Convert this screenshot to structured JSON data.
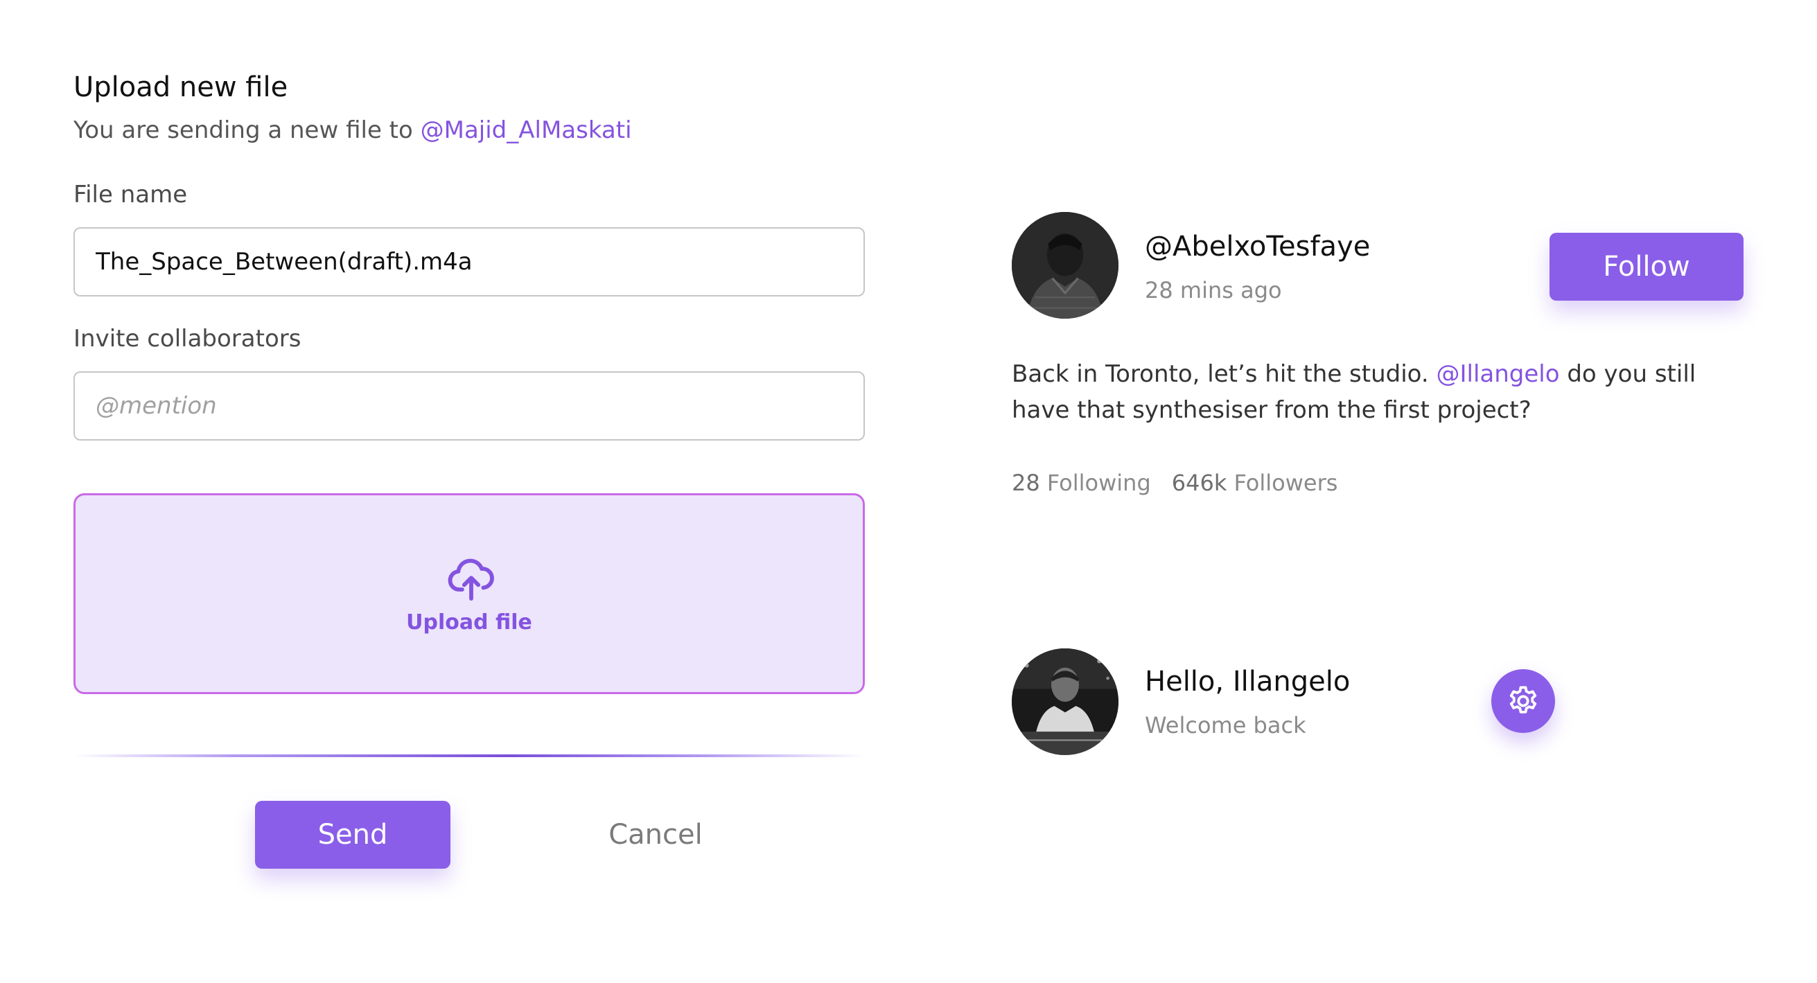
{
  "upload": {
    "title": "Upload new file",
    "subtitle_prefix": "You are sending a new file to ",
    "recipient": "@Majid_AlMaskati",
    "file_name_label": "File name",
    "file_name_value": "The_Space_Between(draft).m4a",
    "collaborators_label": "Invite collaborators",
    "collaborators_placeholder": "@mention",
    "dropzone_label": "Upload file",
    "dropzone_icon": "cloud-upload-icon",
    "send_label": "Send",
    "cancel_label": "Cancel"
  },
  "profile": {
    "username": "@AbelxoTesfaye",
    "timestamp": "28 mins ago",
    "follow_label": "Follow",
    "post_prefix": "Back in Toronto, let’s hit the studio. ",
    "post_mention": "@Illangelo",
    "post_suffix": " do you still have that synthesiser from the first project?",
    "following_count": "28",
    "following_label": "Following",
    "followers_count": "646k",
    "followers_label": "Followers"
  },
  "greeting": {
    "title": "Hello, Illangelo",
    "subtitle": "Welcome back",
    "settings_icon": "gear-icon"
  },
  "colors": {
    "accent": "#8a5ee8",
    "mention": "#8453e0",
    "dropzone_bg": "#ece5fb",
    "dropzone_border": "#c96ae6"
  }
}
